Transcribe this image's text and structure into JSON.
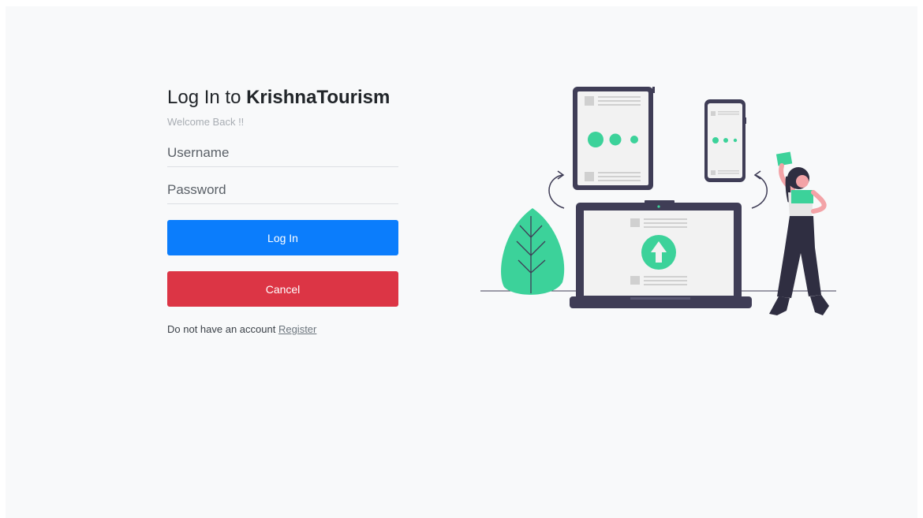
{
  "login": {
    "title_prefix": "Log In to ",
    "title_brand": "KrishnaTourism",
    "subtitle": "Welcome Back !!",
    "username_placeholder": "Username",
    "password_placeholder": "Password",
    "login_label": "Log In",
    "cancel_label": "Cancel",
    "register_prompt": "Do not have an account",
    "register_link": "Register"
  },
  "colors": {
    "background": "#f8f9fa",
    "primary": "#0b7dfc",
    "danger": "#dc3545",
    "accent_green": "#3cd29a",
    "device_dark": "#3f3d56"
  },
  "illustration": {
    "icons": [
      "tablet-icon",
      "phone-icon",
      "laptop-icon",
      "upload-arrow-icon",
      "leaf-icon",
      "person-figure"
    ]
  }
}
